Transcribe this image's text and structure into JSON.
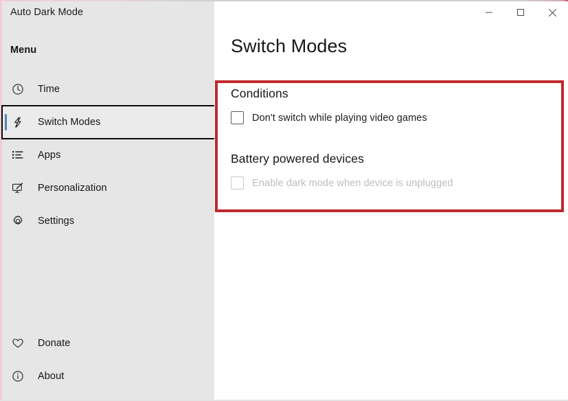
{
  "window": {
    "app_title": "Auto Dark Mode",
    "controls": [
      {
        "name": "minimize",
        "glyph": "minimize-icon",
        "label": "–"
      },
      {
        "name": "maximize",
        "glyph": "maximize-icon",
        "label": "☐"
      },
      {
        "name": "close",
        "glyph": "close-icon",
        "label": "×"
      }
    ]
  },
  "sidebar": {
    "menu_heading": "Menu",
    "items": [
      {
        "label": "Time",
        "icon": "clock-icon",
        "selected": false
      },
      {
        "label": "Switch Modes",
        "icon": "lightning-bolt-icon",
        "selected": true
      },
      {
        "label": "Apps",
        "icon": "list-icon",
        "selected": false
      },
      {
        "label": "Personalization",
        "icon": "monitor-brush-icon",
        "selected": false
      },
      {
        "label": "Settings",
        "icon": "gear-icon",
        "selected": false
      }
    ],
    "bottom_items": [
      {
        "label": "Donate",
        "icon": "heart-icon"
      },
      {
        "label": "About",
        "icon": "info-circle-icon"
      }
    ]
  },
  "main": {
    "page_title": "Switch Modes",
    "sections": [
      {
        "heading": "Conditions",
        "options": [
          {
            "label": "Don't switch while playing video games",
            "checked": false,
            "disabled": false
          }
        ]
      },
      {
        "heading": "Battery powered devices",
        "options": [
          {
            "label": "Enable dark mode when device is unplugged",
            "checked": false,
            "disabled": true
          }
        ]
      }
    ]
  },
  "annotation": {
    "shape": "rectangle",
    "color": "#c1272d",
    "note": "highlight around Conditions and Battery powered devices settings"
  },
  "colors": {
    "sidebar_background": "#e6e6e6",
    "content_background": "#ffffff",
    "accent_bar": "#4a87b8",
    "selection_outline": "#0a0a0a",
    "annotation_red": "#c1272d",
    "text_primary": "#171717",
    "text_disabled": "#bdbdbd",
    "window_edge_pink": "#f0cdd6"
  }
}
